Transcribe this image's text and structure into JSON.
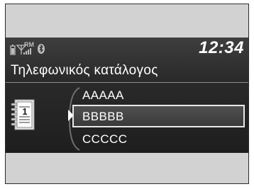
{
  "status": {
    "signal_tag": "RM",
    "time": "12:34"
  },
  "title": "Τηλεφωνικός κατάλογος",
  "phonebook": {
    "book_number": "1",
    "entries": [
      "AAAAA",
      "BBBBB",
      "CCCCC"
    ],
    "selected_index": 1
  },
  "colors": {
    "screen_bg": "#2a2a2a",
    "bezel": "#d2d2d2",
    "text": "#ffffff",
    "highlight_border": "#e8e8e8"
  },
  "icons": [
    "battery-icon",
    "signal-icon",
    "bluetooth-icon",
    "phonebook-icon"
  ]
}
